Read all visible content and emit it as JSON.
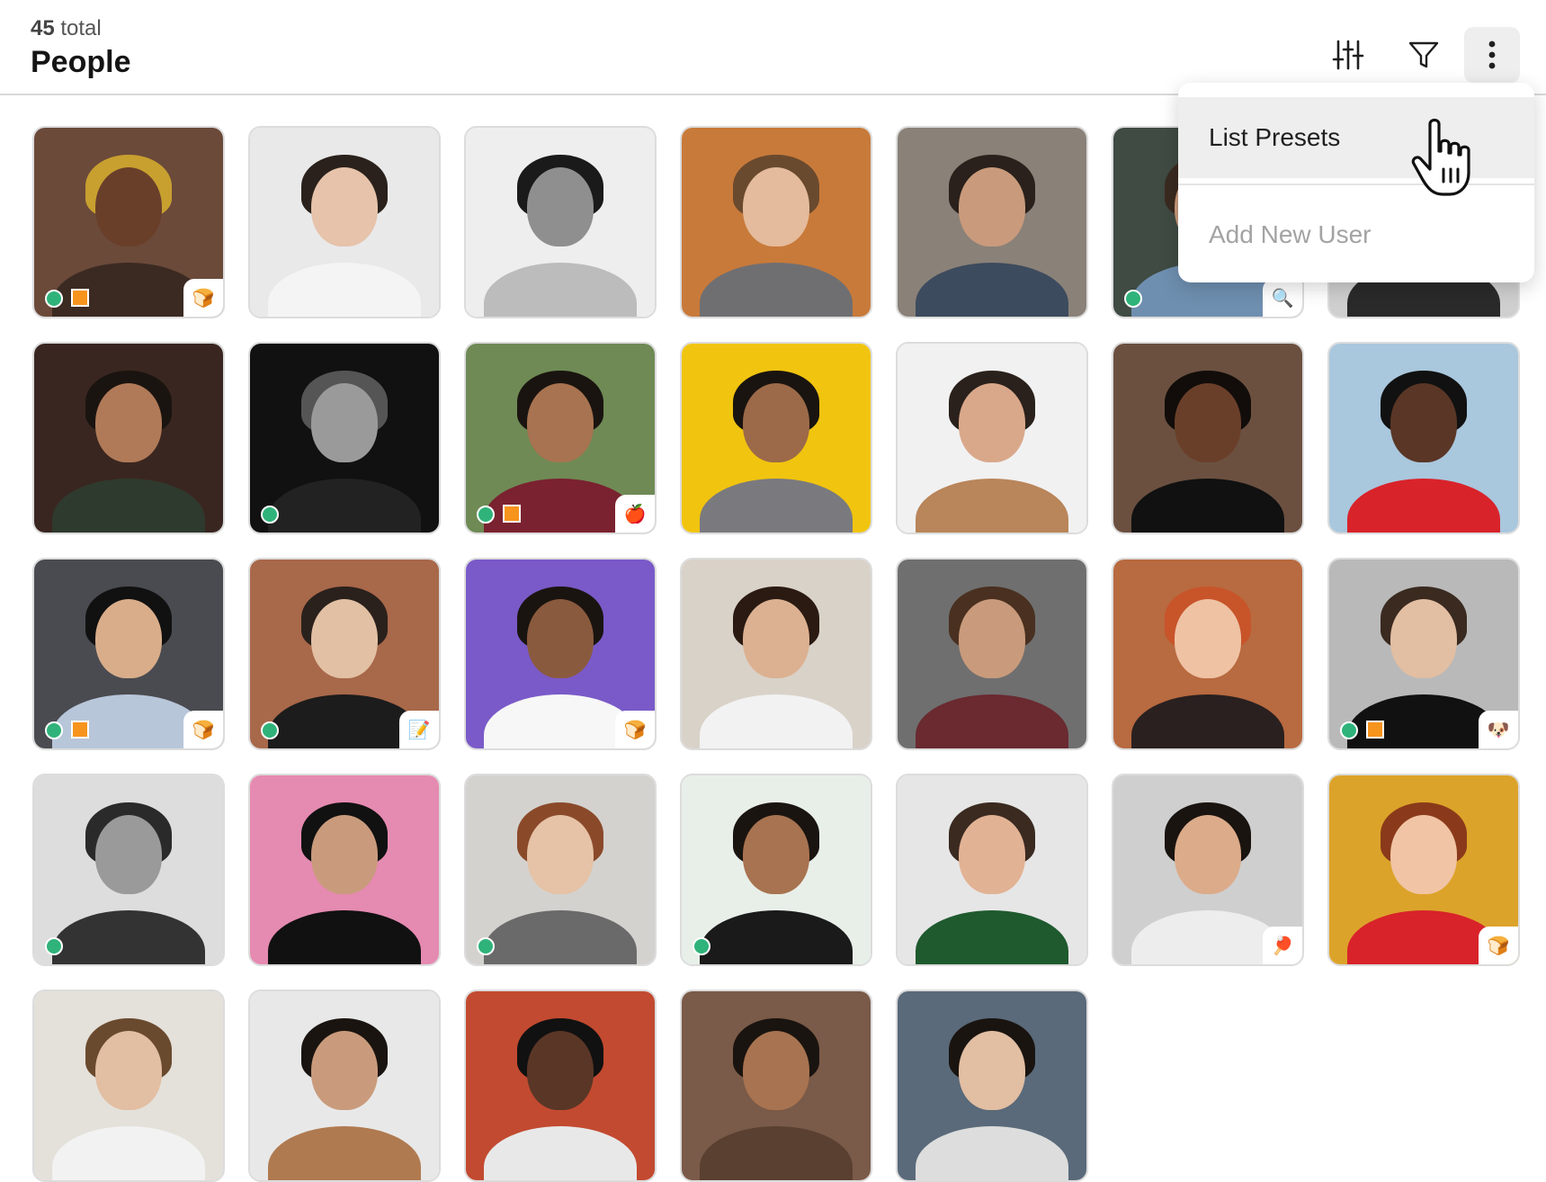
{
  "header": {
    "count": "45",
    "count_suffix": "total",
    "title": "People"
  },
  "toolbar": {
    "adjust_icon": "sliders-icon",
    "filter_icon": "filter-icon",
    "more_icon": "more-vertical-icon"
  },
  "menu": {
    "items": [
      {
        "label": "List Presets",
        "state": "hovered"
      },
      {
        "label": "Add New User",
        "state": "disabled"
      }
    ]
  },
  "people": [
    {
      "bg": "#6b4a3a",
      "skin": "#6a3f2a",
      "hair": "#c8a030",
      "shirt": "#3b2a22",
      "online": true,
      "flag": true,
      "badge": "bread-icon"
    },
    {
      "bg": "#e9e9e9",
      "skin": "#e6c3aa",
      "hair": "#2a211c",
      "shirt": "#f4f4f4",
      "online": false,
      "flag": false,
      "badge": ""
    },
    {
      "bg": "#eeeeee",
      "skin": "#8f8f8f",
      "hair": "#1a1a1a",
      "shirt": "#bcbcbc",
      "online": false,
      "flag": false,
      "badge": ""
    },
    {
      "bg": "#c87a3a",
      "skin": "#e4bb9c",
      "hair": "#6a4a2e",
      "shirt": "#6f6f72",
      "online": false,
      "flag": false,
      "badge": ""
    },
    {
      "bg": "#8a8178",
      "skin": "#c99b7c",
      "hair": "#2a211c",
      "shirt": "#3d4b5e",
      "online": false,
      "flag": false,
      "badge": ""
    },
    {
      "bg": "#3f4b43",
      "skin": "#c99b7c",
      "hair": "#3a2a20",
      "shirt": "#6f8fb0",
      "online": true,
      "flag": false,
      "badge": "magnifier-icon"
    },
    {
      "bg": "#cfcfcf",
      "skin": "#8a5a3e",
      "hair": "#1a1a1a",
      "shirt": "#2a2a2a",
      "online": false,
      "flag": false,
      "badge": ""
    },
    {
      "bg": "#3a2620",
      "skin": "#b07a58",
      "hair": "#1a1410",
      "shirt": "#2f3a2e",
      "online": false,
      "flag": false,
      "badge": ""
    },
    {
      "bg": "#111111",
      "skin": "#9a9a9a",
      "hair": "#555555",
      "shirt": "#222222",
      "online": true,
      "flag": false,
      "badge": ""
    },
    {
      "bg": "#6f8a55",
      "skin": "#a87350",
      "hair": "#1a1410",
      "shirt": "#7a2230",
      "online": true,
      "flag": true,
      "badge": "apple-icon"
    },
    {
      "bg": "#f1c40f",
      "skin": "#9c6a48",
      "hair": "#1a1410",
      "shirt": "#7a7a7e",
      "online": false,
      "flag": false,
      "badge": ""
    },
    {
      "bg": "#f1f1f1",
      "skin": "#d9a88a",
      "hair": "#2a211c",
      "shirt": "#b9855a",
      "online": false,
      "flag": false,
      "badge": ""
    },
    {
      "bg": "#6b5040",
      "skin": "#6a3f2a",
      "hair": "#120d0a",
      "shirt": "#111111",
      "online": false,
      "flag": false,
      "badge": ""
    },
    {
      "bg": "#a9c7dd",
      "skin": "#5a3626",
      "hair": "#111111",
      "shirt": "#d8232a",
      "online": false,
      "flag": false,
      "badge": ""
    },
    {
      "bg": "#4a4b50",
      "skin": "#d9ad8a",
      "hair": "#111111",
      "shirt": "#b8c6da",
      "online": true,
      "flag": true,
      "badge": "bread-icon"
    },
    {
      "bg": "#a8684a",
      "skin": "#e2c0a4",
      "hair": "#2a211c",
      "shirt": "#1c1c1c",
      "online": true,
      "flag": false,
      "badge": "notepad-icon"
    },
    {
      "bg": "#7a5ac8",
      "skin": "#8a5a3e",
      "hair": "#1a1410",
      "shirt": "#f7f7f7",
      "online": false,
      "flag": false,
      "badge": "bread-icon"
    },
    {
      "bg": "#d9d2c8",
      "skin": "#dcb191",
      "hair": "#2a1a12",
      "shirt": "#f2f2f2",
      "online": false,
      "flag": false,
      "badge": ""
    },
    {
      "bg": "#6f6f6f",
      "skin": "#c99b7c",
      "hair": "#4a3020",
      "shirt": "#6a2a30",
      "online": false,
      "flag": false,
      "badge": ""
    },
    {
      "bg": "#b86a40",
      "skin": "#efc2a4",
      "hair": "#c8542a",
      "shirt": "#2a2020",
      "online": false,
      "flag": false,
      "badge": ""
    },
    {
      "bg": "#b9b9b9",
      "skin": "#e2bea2",
      "hair": "#3a2a20",
      "shirt": "#111111",
      "online": true,
      "flag": true,
      "badge": "dog-icon"
    },
    {
      "bg": "#dddddd",
      "skin": "#9a9a9a",
      "hair": "#2a2a2a",
      "shirt": "#333333",
      "online": true,
      "flag": false,
      "badge": ""
    },
    {
      "bg": "#e58ab0",
      "skin": "#c99b7c",
      "hair": "#111111",
      "shirt": "#111111",
      "online": false,
      "flag": false,
      "badge": ""
    },
    {
      "bg": "#d4d2ce",
      "skin": "#e6c2a6",
      "hair": "#8a4a2a",
      "shirt": "#6a6a6a",
      "online": true,
      "flag": false,
      "badge": ""
    },
    {
      "bg": "#e8efe8",
      "skin": "#a87350",
      "hair": "#1a1410",
      "shirt": "#1a1a1a",
      "online": true,
      "flag": false,
      "badge": ""
    },
    {
      "bg": "#e6e6e6",
      "skin": "#e2b294",
      "hair": "#3a2a20",
      "shirt": "#1f5a2e",
      "online": false,
      "flag": false,
      "badge": ""
    },
    {
      "bg": "#cfcfcf",
      "skin": "#dcab8a",
      "hair": "#1a1410",
      "shirt": "#ededed",
      "online": false,
      "flag": false,
      "badge": "pingpong-icon"
    },
    {
      "bg": "#dca32a",
      "skin": "#f0c4a4",
      "hair": "#8a3a1a",
      "shirt": "#d8232a",
      "online": false,
      "flag": false,
      "badge": "bread-icon"
    },
    {
      "bg": "#e4e0da",
      "skin": "#e2bea2",
      "hair": "#6a4a2e",
      "shirt": "#f2f2f2",
      "online": false,
      "flag": false,
      "badge": ""
    },
    {
      "bg": "#e8e8e8",
      "skin": "#c99b7c",
      "hair": "#1a1410",
      "shirt": "#b07a50",
      "online": false,
      "flag": false,
      "badge": ""
    },
    {
      "bg": "#c24a30",
      "skin": "#5a3626",
      "hair": "#111111",
      "shirt": "#e8e8e8",
      "online": false,
      "flag": false,
      "badge": ""
    },
    {
      "bg": "#7a5a48",
      "skin": "#a87350",
      "hair": "#1a1410",
      "shirt": "#5a4030",
      "online": false,
      "flag": false,
      "badge": ""
    },
    {
      "bg": "#5a6a7a",
      "skin": "#e2bea2",
      "hair": "#1a1410",
      "shirt": "#dddddd",
      "online": false,
      "flag": false,
      "badge": ""
    }
  ]
}
